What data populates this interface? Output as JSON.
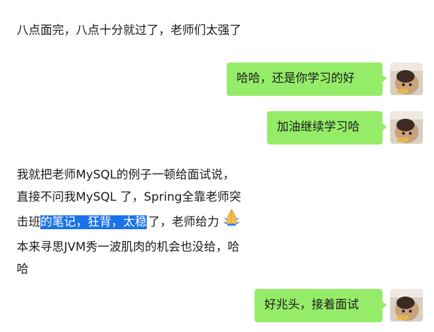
{
  "messages": [
    {
      "side": "left",
      "text": "八点面完，八点十分就过了，老师们太强了"
    },
    {
      "side": "right",
      "text": "哈哈，还是你学习的好"
    },
    {
      "side": "right",
      "text": "加油继续学习哈"
    },
    {
      "side": "left",
      "line1": "我就把老师MySQL的例子一顿给面试说，",
      "line2": "直接不问我MySQL 了，Spring全靠老师突",
      "line3_pre": "击班",
      "line3_selected": "的笔记，狂背，太稳",
      "line3_post": "了，老师给力",
      "emoji": "clap-emoji",
      "line4": "本来寻思JVM秀一波肌肉的机会也没给，哈",
      "line5": "哈"
    },
    {
      "side": "right",
      "text": "好兆头，接着面试"
    }
  ],
  "colors": {
    "bubble_green": "#95ec69",
    "selection_blue": "#1a73e8",
    "text": "#1a1a1a"
  }
}
